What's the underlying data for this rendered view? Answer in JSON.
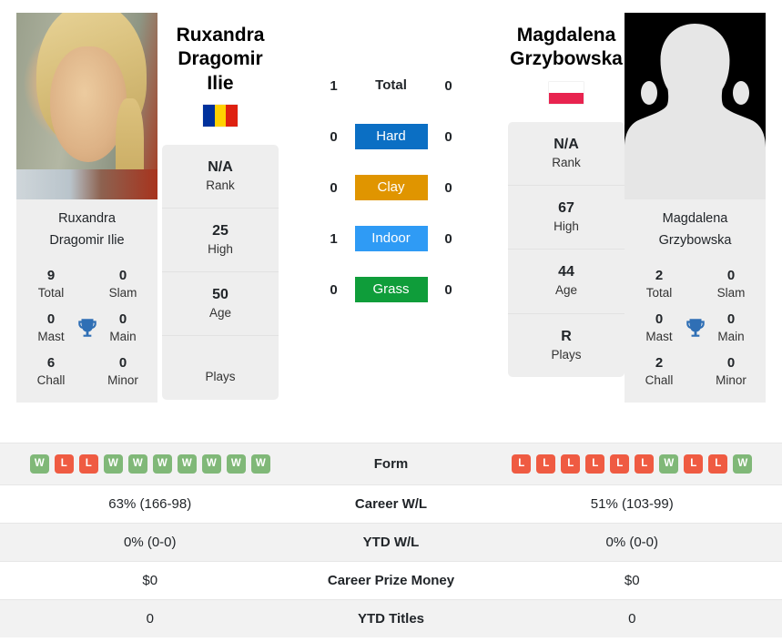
{
  "players": {
    "left": {
      "display_name_line1": "Ruxandra",
      "display_name_line2": "Dragomir Ilie",
      "caption_line1": "Ruxandra",
      "caption_line2": "Dragomir Ilie",
      "flag": {
        "name": "romania-flag",
        "type": "vertical",
        "colors": [
          "#00319c",
          "#ffd100",
          "#de2110"
        ]
      },
      "photo": {
        "name": "player-photo-ruxandra-dragomir-ilie",
        "kind": "portrait"
      },
      "titles": [
        {
          "value": "9",
          "label": "Total"
        },
        {
          "value": "0",
          "label": "Slam"
        },
        {
          "value": "0",
          "label": "Mast"
        },
        {
          "value": "0",
          "label": "Main"
        },
        {
          "value": "6",
          "label": "Chall"
        },
        {
          "value": "0",
          "label": "Minor"
        }
      ],
      "info": [
        {
          "value": "N/A",
          "label": "Rank"
        },
        {
          "value": "25",
          "label": "High"
        },
        {
          "value": "50",
          "label": "Age"
        },
        {
          "value": "",
          "label": "Plays"
        }
      ],
      "form": [
        "W",
        "L",
        "L",
        "W",
        "W",
        "W",
        "W",
        "W",
        "W",
        "W"
      ],
      "career_wl": "63% (166-98)",
      "ytd_wl": "0% (0-0)",
      "career_prize_money": "$0",
      "ytd_titles": "0"
    },
    "right": {
      "display_name_line1": "Magdalena",
      "display_name_line2": "Grzybowska",
      "caption_line1": "Magdalena",
      "caption_line2": "Grzybowska",
      "flag": {
        "name": "poland-flag",
        "type": "horizontal",
        "colors": [
          "#ffffff",
          "#e8234f"
        ]
      },
      "photo": {
        "name": "player-photo-placeholder-silhouette",
        "kind": "silhouette"
      },
      "titles": [
        {
          "value": "2",
          "label": "Total"
        },
        {
          "value": "0",
          "label": "Slam"
        },
        {
          "value": "0",
          "label": "Mast"
        },
        {
          "value": "0",
          "label": "Main"
        },
        {
          "value": "2",
          "label": "Chall"
        },
        {
          "value": "0",
          "label": "Minor"
        }
      ],
      "info": [
        {
          "value": "N/A",
          "label": "Rank"
        },
        {
          "value": "67",
          "label": "High"
        },
        {
          "value": "44",
          "label": "Age"
        },
        {
          "value": "R",
          "label": "Plays"
        }
      ],
      "form": [
        "L",
        "L",
        "L",
        "L",
        "L",
        "L",
        "W",
        "L",
        "L",
        "W"
      ],
      "career_wl": "51% (103-99)",
      "ytd_wl": "0% (0-0)",
      "career_prize_money": "$0",
      "ytd_titles": "0"
    }
  },
  "h2h_surfaces": [
    {
      "label": "Total",
      "left": "1",
      "right": "0",
      "badge_color": "",
      "plain": true
    },
    {
      "label": "Hard",
      "left": "0",
      "right": "0",
      "badge_color": "#0b6fc4",
      "plain": false
    },
    {
      "label": "Clay",
      "left": "0",
      "right": "0",
      "badge_color": "#e09500",
      "plain": false
    },
    {
      "label": "Indoor",
      "left": "1",
      "right": "0",
      "badge_color": "#2f9bf5",
      "plain": false
    },
    {
      "label": "Grass",
      "left": "0",
      "right": "0",
      "badge_color": "#0f9d3a",
      "plain": false
    }
  ],
  "comparison_rows": [
    {
      "label": "Form",
      "key": "form",
      "type": "badges"
    },
    {
      "label": "Career W/L",
      "key": "career_wl",
      "type": "text"
    },
    {
      "label": "YTD W/L",
      "key": "ytd_wl",
      "type": "text"
    },
    {
      "label": "Career Prize Money",
      "key": "career_prize_money",
      "type": "text"
    },
    {
      "label": "YTD Titles",
      "key": "ytd_titles",
      "type": "text"
    }
  ],
  "colors": {
    "form_win": "#80b878",
    "form_loss": "#ef5b42",
    "card_bg": "#eeeeee",
    "row_shade": "#f2f2f2",
    "trophy": "#2f6fb5"
  }
}
